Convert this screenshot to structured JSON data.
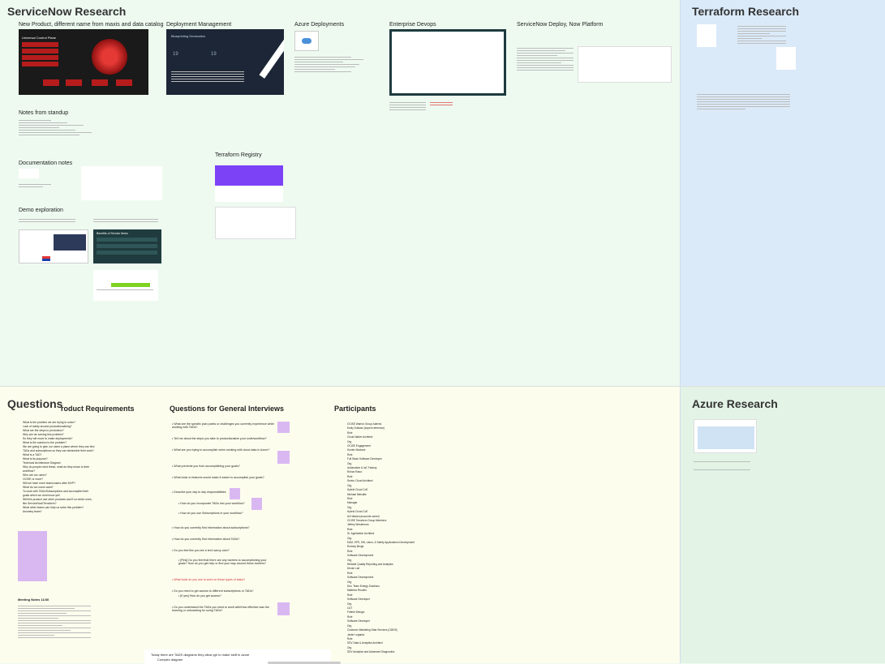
{
  "sections": {
    "servicenow": {
      "title": "ServiceNow Research",
      "frames": {
        "new_product": "New Product, different name from maxis and data catalog",
        "deployment": "Deployment Management",
        "azure_deployments": "Azure Deployments",
        "enterprise_devops": "Enterprise Devops",
        "sn_deploy": "ServiceNow Deploy, Now Platform",
        "notes_standup": "Notes from standup",
        "documentation": "Documentation notes",
        "terraform_registry": "Terraform Registry",
        "demo": "Demo exploration"
      },
      "red_panel": {
        "title": "Universal Control Plane"
      },
      "deployment_panel": {
        "title": "Blueprinting Generation",
        "number_a": "19",
        "number_b": "19"
      },
      "demo_panel": {
        "title": "Benefits of Service Items"
      }
    },
    "terraform": {
      "title": "Terraform Research"
    },
    "azure": {
      "title": "Azure Research"
    },
    "questions": {
      "title": "Questions",
      "product_requirements": {
        "heading": "roduct Requirements",
        "items": [
          "What is the problem we are trying to solve?",
          "Lack of clarity around productionalizing?",
          "What are the steps to production?",
          "Why are we solving this problem?",
          "So they will move to make deployments?",
          "What is the solution to the problem?",
          "We are going to give our users a place where they can find",
          "TADs and subscriptions so they can streamline their work?",
          "What is a TAD?",
          "What is its purpose?",
          "Technical Architecture Diagram",
          "Why do people need these, what do they mean to their",
          "workflow?",
          "Who are our users?",
          "OCISE or more?",
          "Will we have more teams/users after MVP?",
          "What do our users want?",
          "To work with TADs/Subscriptions and accomplish their",
          "goals which we dont know yet!",
          "Will this product use other products and if so which ones,",
          "like ServiceNow/Terraform?",
          "What other teams can help us solve this problem?",
          "Ancestry team?"
        ],
        "meeting": "Meeting Notes 11/30"
      },
      "general": {
        "heading": "Questions for General Interviews",
        "items": [
          "What are the specific pain points or challenges you currently experience while working with TADs?",
          "Tell me about the steps you take to productionalize your code/workflow?",
          "What are you trying to accomplish when working with cloud data in Azure?",
          "What prevents you from accomplishing your goals?",
          "What tools or features would make it easier to accomplish your goals?",
          "Describe your day to day responsibilities",
          "How do you incorporate TADs into your workflow?",
          "How do you use Subscriptions in your workflow?",
          "How do you currently find information about subscriptions?",
          "How do you currently find information about TADs?",
          "Do you feel like you are a tech savvy user?",
          "[Pink] Do you feel that there are any barriers to accomplishing your goals? How do you get help or find your way around these barriers?",
          "What tools do you use to work on these types of tasks?",
          "Do you need to get access to different subscriptions or TADs?",
          "[If yes] How do you get access?",
          "Do you understand the TADs you need to work with/How effective was the learning or onboarding for using TADs?"
        ],
        "footer_1": "Today there are TADS diagrams they allow ppl to make stuff in azure",
        "footer_2": "Complex diagram"
      },
      "participants": {
        "heading": "Participants",
        "items": [
          "OCISE Warrior Group Admins",
          "Emily Sullivan (expert reference)",
          "Role",
          "Cloud Native Architect",
          "Org",
          "OCISE Engagement",
          "Hunter Marlowe",
          "Role",
          "Full Stack Software Developer",
          "Org",
          "Automation & IaC Factory",
          "Rohan Rana",
          "Role",
          "Senior Cloud Architect",
          "Org",
          "Hybrid Cloud CoE",
          "Michael Metcalfe",
          "Role",
          "Manager",
          "Org",
          "Hybrid Cloud CoE",
          "Ali Haidari (accounts owner)",
          "OCISE Terraform Group Members",
          "Jeffrey Westerman",
          "Role",
          "Sr. Application Architect",
          "Org",
          "EAM, HPS, SW, Labor, & Safety Applications Development",
          "Rodney Berge",
          "Role",
          "Software Development",
          "Org",
          "Website Quality Reporting and Analytics",
          "Devan Lail",
          "Role",
          "Software Development",
          "Org",
          "Dev. Team Energy Solutions",
          "Matthew Rhodes",
          "Role",
          "Software Developer",
          "Org",
          "CAT",
          "Fritesh Wenglo",
          "Role",
          "Software Developer",
          "Org",
          "Customer Marketing Data Services (CMDS)",
          "Javier Legarda",
          "Role",
          "SDV Data & Analytics Architect",
          "Org",
          "SDV Analytics and Advanced Diagnostics"
        ]
      }
    }
  },
  "colors": {
    "green_bg": "#eefaf0",
    "blue_bg": "#dbeaf9",
    "yellow_bg": "#fdfdee",
    "sticky": "#d9b8f2",
    "red": "#c62828"
  }
}
